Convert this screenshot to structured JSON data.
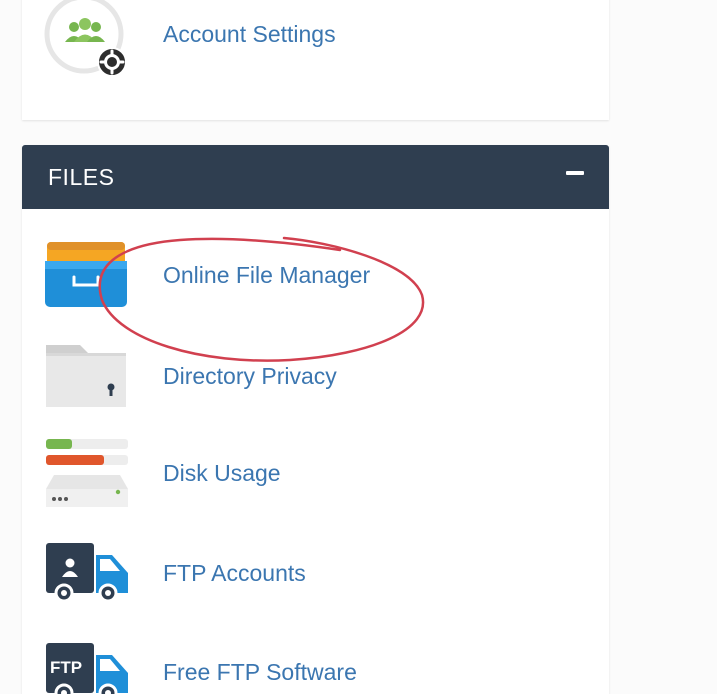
{
  "account_settings": {
    "label": "Account Settings",
    "icon": "account-settings-icon"
  },
  "files_section": {
    "title": "FILES",
    "collapse_icon": "minus-icon",
    "items": [
      {
        "label": "Online File Manager",
        "icon": "file-manager-icon"
      },
      {
        "label": "Directory Privacy",
        "icon": "directory-privacy-icon"
      },
      {
        "label": "Disk Usage",
        "icon": "disk-usage-icon"
      },
      {
        "label": "FTP Accounts",
        "icon": "ftp-accounts-icon"
      },
      {
        "label": "Free FTP Software",
        "icon": "free-ftp-software-icon"
      }
    ]
  },
  "colors": {
    "header_bg": "#2f3e50",
    "link": "#3b76b0",
    "annotation": "#d1404f"
  }
}
